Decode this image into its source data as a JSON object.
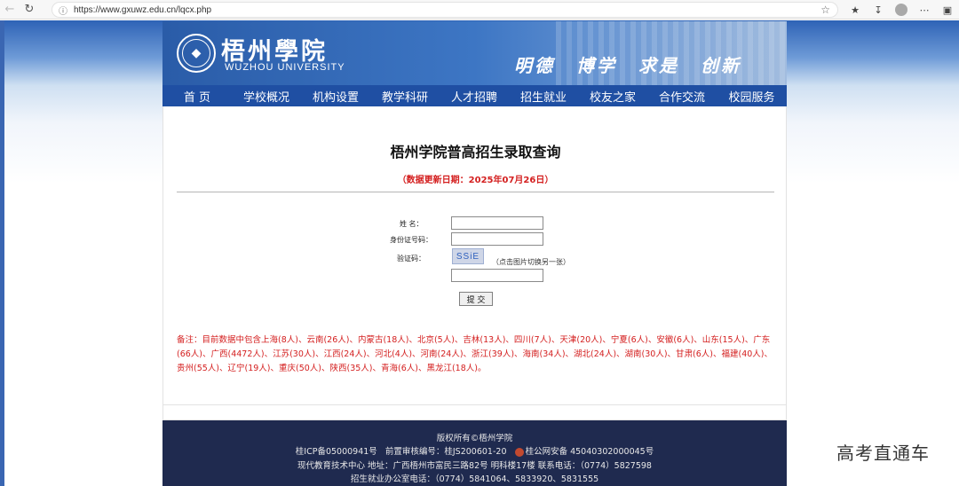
{
  "browser": {
    "url": "https://www.gxuwz.edu.cn/lqcx.php"
  },
  "header": {
    "school_cn": "梧州學院",
    "school_en": "WUZHOU UNIVERSITY",
    "motto": [
      "明德",
      "博学",
      "求是",
      "创新"
    ]
  },
  "nav": {
    "items": [
      "首 页",
      "学校概况",
      "机构设置",
      "教学科研",
      "人才招聘",
      "招生就业",
      "校友之家",
      "合作交流",
      "校园服务"
    ]
  },
  "main": {
    "title": "梧州学院普高招生录取查询",
    "update_date": "（数据更新日期：2025年07月26日）",
    "form": {
      "name_label": "姓 名：",
      "id_label": "身份证号码：",
      "captcha_label": "验证码：",
      "captcha_text": "SSiE",
      "captcha_hint": "（点击图片切换另一张）",
      "submit_label": "提 交"
    },
    "note": "备注：目前数据中包含上海(8人)、云南(26人)、内蒙古(18人)、北京(5人)、吉林(13人)、四川(7人)、天津(20人)、宁夏(6人)、安徽(6人)、山东(15人)、广东(66人)、广西(4472人)、江苏(30人)、江西(24人)、河北(4人)、河南(24人)、浙江(39人)、海南(34人)、湖北(24人)、湖南(30人)、甘肃(6人)、福建(40人)、贵州(55人)、辽宁(19人)、重庆(50人)、陕西(35人)、青海(6人)、黑龙江(18人)。"
  },
  "footer": {
    "copyright": "版权所有©梧州学院",
    "icp": "桂ICP备05000941号",
    "pre_approval": "前置审核编号：桂JS200601-20",
    "police": "桂公网安备 45040302000045号",
    "address_line": "现代教育技术中心 地址：广西梧州市富民三路82号 明科楼17楼 联系电话：（0774）5827598",
    "admissions_line": "招生就业办公室电话：（0774）5841064、5833920、5831555"
  },
  "watermark": "高考直通车"
}
